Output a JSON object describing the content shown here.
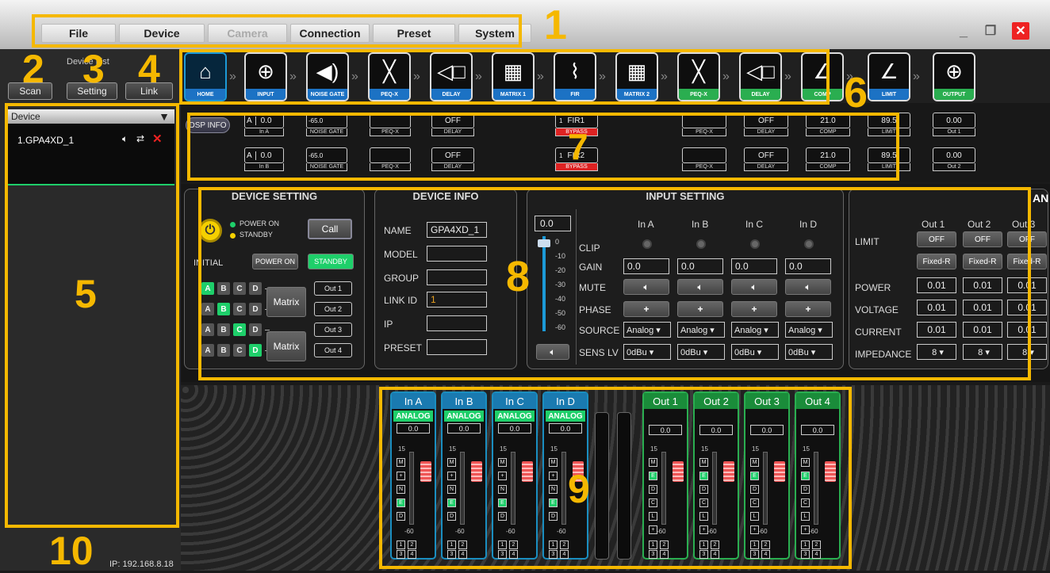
{
  "menu": {
    "file": "File",
    "device": "Device",
    "camera": "Camera",
    "connection": "Connection",
    "preset": "Preset",
    "system": "System"
  },
  "window": {
    "minimize": "_",
    "restore": "❐",
    "close": "✕"
  },
  "left": {
    "device_list": "Device List",
    "scan": "Scan",
    "setting": "Setting",
    "link": "Link",
    "device_header": "Device",
    "device_item": "1.GPA4XD_1",
    "ip": "IP: 192.168.8.18"
  },
  "blocks": [
    {
      "label": "HOME",
      "icon": "⌂",
      "color": "blue"
    },
    {
      "label": "INPUT",
      "icon": "⊕",
      "color": "blue"
    },
    {
      "label": "NOISE GATE",
      "icon": "◀)",
      "color": "blue"
    },
    {
      "label": "PEQ-X",
      "icon": "╳",
      "color": "blue"
    },
    {
      "label": "DELAY",
      "icon": "◁□",
      "color": "blue"
    },
    {
      "label": "MATRIX 1",
      "icon": "▦",
      "color": "blue"
    },
    {
      "label": "FIR",
      "icon": "⌇",
      "color": "blue"
    },
    {
      "label": "MATRIX 2",
      "icon": "▦",
      "color": "blue"
    },
    {
      "label": "PEQ-X",
      "icon": "╳",
      "color": "green"
    },
    {
      "label": "DELAY",
      "icon": "◁□",
      "color": "green"
    },
    {
      "label": "COMP",
      "icon": "∠",
      "color": "green"
    },
    {
      "label": "LIMIT",
      "icon": "∠",
      "color": "blue"
    },
    {
      "label": "OUTPUT",
      "icon": "⊕",
      "color": "green"
    }
  ],
  "dsp": {
    "dsp_info": "DSP INFO",
    "row1": {
      "ch": "A",
      "gain": "0.0",
      "in": "In A",
      "ng_val": "-65.0",
      "ng": "NOISE GATE",
      "peq": "PEQ-X",
      "delay_val": "OFF",
      "delay": "DELAY",
      "fir_num": "1",
      "fir": "FIR1",
      "bypass": "BYPASS",
      "peq2": "PEQ-X",
      "delay2_val": "OFF",
      "delay2": "DELAY",
      "comp_val": "21.0",
      "comp": "COMP",
      "lim_val": "89.5",
      "lim": "LIMIT",
      "out_val": "0.00",
      "out": "Out 1"
    },
    "row2": {
      "ch": "A",
      "gain": "0.0",
      "in": "In B",
      "ng_val": "-65.0",
      "ng": "NOISE GATE",
      "peq": "PEQ-X",
      "delay_val": "OFF",
      "delay": "DELAY",
      "fir_num": "1",
      "fir": "FIR2",
      "bypass": "BYPASS",
      "peq2": "PEQ-X",
      "delay2_val": "OFF",
      "delay2": "DELAY",
      "comp_val": "21.0",
      "comp": "COMP",
      "lim_val": "89.5",
      "lim": "LIMIT",
      "out_val": "0.00",
      "out": "Out 2"
    }
  },
  "device_setting": {
    "title": "DEVICE SETTING",
    "power_on": "POWER ON",
    "standby": "STANDBY",
    "call": "Call",
    "initial": "INITIAL",
    "btn_power_on": "POWER ON",
    "btn_standby": "STANDBY",
    "matrix": "Matrix",
    "outs": [
      "Out 1",
      "Out 2",
      "Out 3",
      "Out 4"
    ],
    "rows": [
      [
        "A",
        "B",
        "C",
        "D"
      ],
      [
        "A",
        "B",
        "C",
        "D"
      ],
      [
        "A",
        "B",
        "C",
        "D"
      ],
      [
        "A",
        "B",
        "C",
        "D"
      ]
    ],
    "active": [
      [
        true,
        false,
        false,
        false
      ],
      [
        false,
        true,
        false,
        false
      ],
      [
        false,
        false,
        true,
        false
      ],
      [
        false,
        false,
        false,
        true
      ]
    ]
  },
  "device_info": {
    "title": "DEVICE INFO",
    "name_l": "NAME",
    "name_v": "GPA4XD_1",
    "model_l": "MODEL",
    "group_l": "GROUP",
    "linkid_l": "LINK ID",
    "linkid_v": "1",
    "ip_l": "IP",
    "preset_l": "PRESET"
  },
  "input_setting": {
    "title": "INPUT SETTING",
    "master": "0.0",
    "scale": [
      "0",
      "-10",
      "-20",
      "-30",
      "-40",
      "-50",
      "-60"
    ],
    "channels": [
      "In A",
      "In B",
      "In C",
      "In D"
    ],
    "clip": "CLIP",
    "gain": "GAIN",
    "mute": "MUTE",
    "phase": "PHASE",
    "source": "SOURCE",
    "sens": "SENS LV",
    "gain_vals": [
      "0.0",
      "0.0",
      "0.0",
      "0.0"
    ],
    "phase_val": "+",
    "source_vals": [
      "Analog",
      "Analog",
      "Analog",
      "Analog"
    ],
    "sens_vals": [
      "0dBu",
      "0dBu",
      "0dBu",
      "0dBu"
    ]
  },
  "amp": {
    "title": "AN",
    "outs": [
      "Out 1",
      "Out 2",
      "Out 3"
    ],
    "limit": "LIMIT",
    "limit_vals": [
      "OFF",
      "OFF",
      "OFF"
    ],
    "fixed": [
      "Fixed-R",
      "Fixed-R",
      "Fixed-R"
    ],
    "power": "POWER",
    "voltage": "VOLTAGE",
    "current": "CURRENT",
    "impedance": "IMPEDANCE",
    "power_vals": [
      "0.01",
      "0.01",
      "0.01"
    ],
    "voltage_vals": [
      "0.01",
      "0.01",
      "0.01"
    ],
    "current_vals": [
      "0.01",
      "0.01",
      "0.01"
    ],
    "imp_vals": [
      "8",
      "8",
      "8"
    ]
  },
  "mixer": {
    "inputs": [
      {
        "name": "In A",
        "tag": "ANALOG",
        "val": "0.0"
      },
      {
        "name": "In B",
        "tag": "ANALOG",
        "val": "0.0"
      },
      {
        "name": "In C",
        "tag": "ANALOG",
        "val": "0.0"
      },
      {
        "name": "In D",
        "tag": "ANALOG",
        "val": "0.0"
      }
    ],
    "outputs": [
      {
        "name": "Out 1",
        "val": "0.0"
      },
      {
        "name": "Out 2",
        "val": "0.0"
      },
      {
        "name": "Out 3",
        "val": "0.0"
      },
      {
        "name": "Out 4",
        "val": "0.0"
      }
    ],
    "top_scale": "15",
    "bottom_scale": "-60"
  },
  "callouts": [
    "1",
    "2",
    "3",
    "4",
    "5",
    "6",
    "7",
    "8",
    "9",
    "10"
  ]
}
